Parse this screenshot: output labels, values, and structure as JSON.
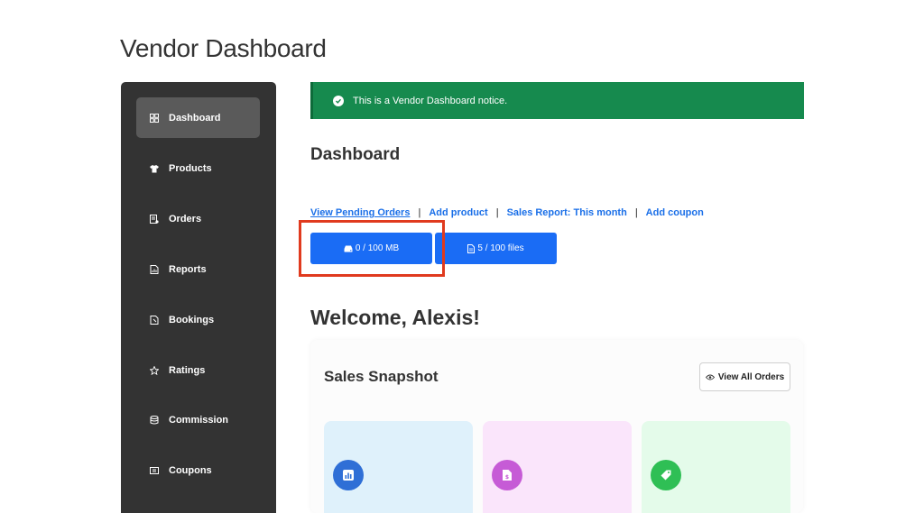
{
  "page_title": "Vendor Dashboard",
  "sidebar": {
    "items": [
      {
        "label": "Dashboard",
        "icon": "dashboard-grid-icon",
        "active": true
      },
      {
        "label": "Products",
        "icon": "tshirt-icon",
        "active": false
      },
      {
        "label": "Orders",
        "icon": "orders-list-icon",
        "active": false
      },
      {
        "label": "Reports",
        "icon": "report-chart-icon",
        "active": false
      },
      {
        "label": "Bookings",
        "icon": "booking-tag-icon",
        "active": false
      },
      {
        "label": "Ratings",
        "icon": "star-icon",
        "active": false
      },
      {
        "label": "Commission",
        "icon": "database-icon",
        "active": false
      },
      {
        "label": "Coupons",
        "icon": "coupon-icon",
        "active": false
      }
    ]
  },
  "notice": {
    "text": "This is a Vendor Dashboard notice.",
    "color": "#168a4e"
  },
  "dashboard": {
    "title": "Dashboard",
    "links": [
      "View Pending Orders",
      "Add product",
      "Sales Report: This month",
      "Add coupon"
    ],
    "storage_label": "0 / 100 MB",
    "files_label": "5 / 100 files",
    "welcome": "Welcome, Alexis!"
  },
  "sales_snapshot": {
    "title": "Sales Snapshot",
    "view_all": "View All Orders"
  },
  "colors": {
    "accent": "#1a6cf5",
    "link": "#1a6fe8",
    "highlight": "#e03a1e",
    "card_blue": "#dff1fb",
    "card_pink": "#fae5fb",
    "card_green": "#e4fbea"
  }
}
